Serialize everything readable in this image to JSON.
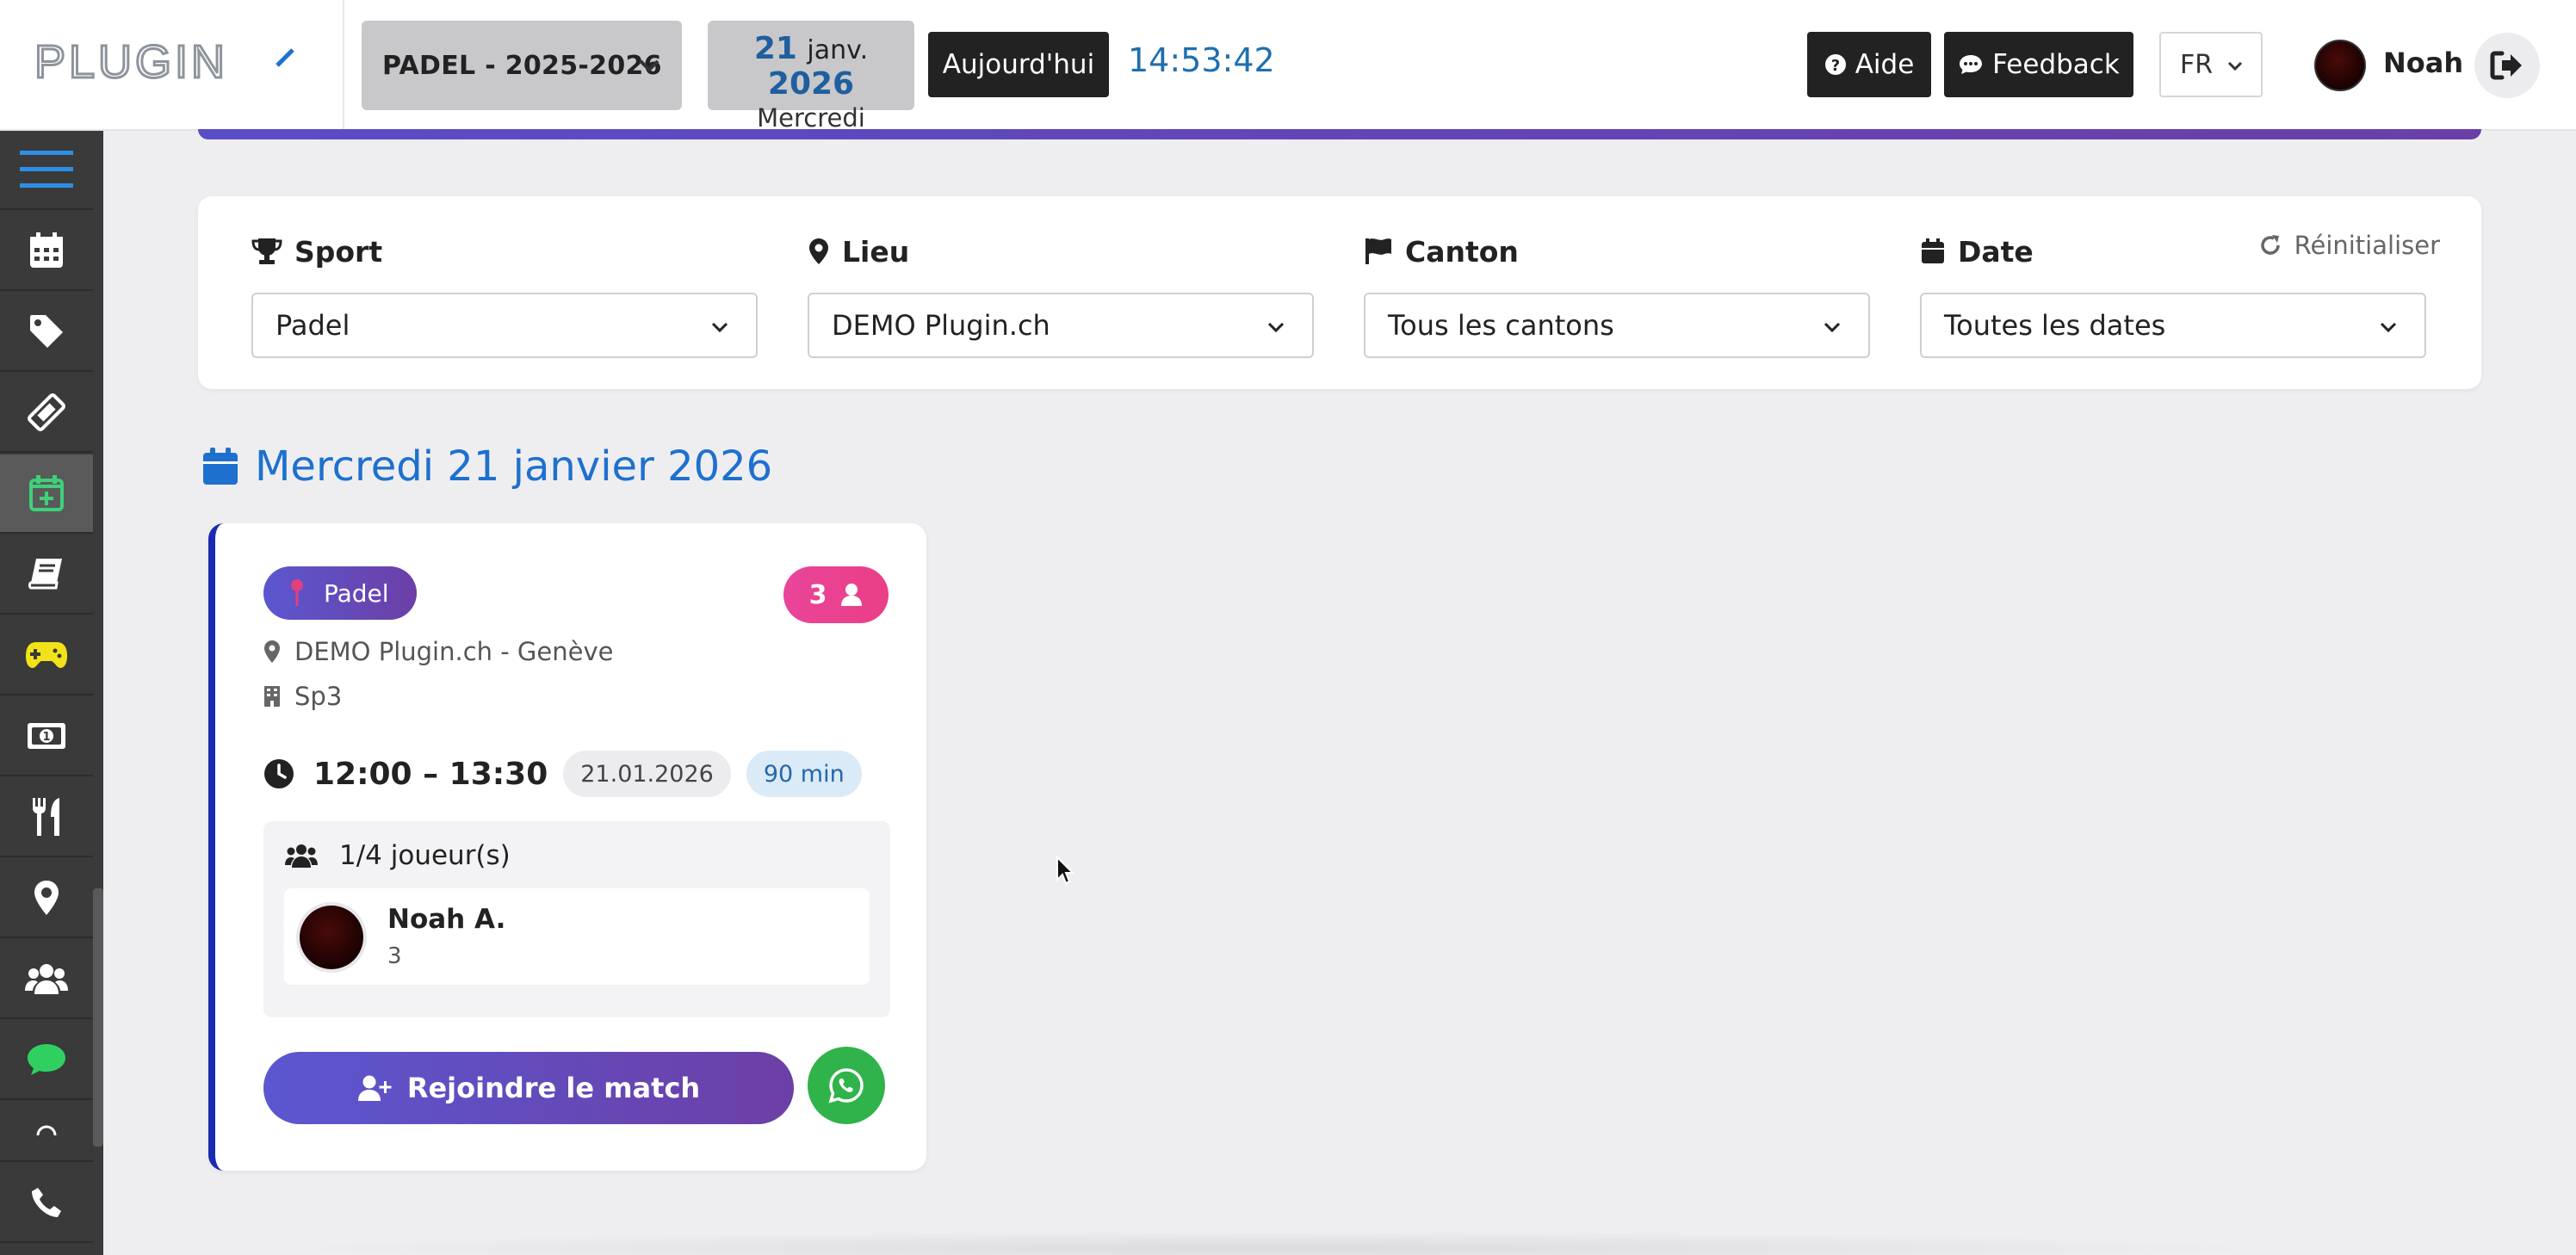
{
  "header": {
    "logo_text": "PLUGIN",
    "season": "PADEL - 2025-2026",
    "date": {
      "day": "21",
      "month": "janv.",
      "year": "2026",
      "weekday": "Mercredi"
    },
    "today_label": "Aujourd'hui",
    "clock": "14:53:42",
    "help_label": "Aide",
    "feedback_label": "Feedback",
    "language": "FR",
    "user_name": "Noah"
  },
  "sidebar": {
    "items": [
      {
        "icon": "menu-icon"
      },
      {
        "icon": "calendar-icon"
      },
      {
        "icon": "tag-icon"
      },
      {
        "icon": "ticket-icon"
      },
      {
        "icon": "calendar-plus-icon",
        "active": true
      },
      {
        "icon": "book-icon"
      },
      {
        "icon": "gamepad-icon"
      },
      {
        "icon": "money-icon"
      },
      {
        "icon": "utensils-icon"
      },
      {
        "icon": "map-marker-icon"
      },
      {
        "icon": "users-icon"
      },
      {
        "icon": "chat-icon"
      },
      {
        "icon": "loading-icon"
      },
      {
        "icon": "phone-icon"
      }
    ],
    "colors": {
      "calendar-plus": "#3fd07a",
      "gamepad": "#f2e21a",
      "chat": "#2fd060"
    }
  },
  "filters": {
    "sport": {
      "label": "Sport",
      "value": "Padel"
    },
    "lieu": {
      "label": "Lieu",
      "value": "DEMO Plugin.ch"
    },
    "canton": {
      "label": "Canton",
      "value": "Tous les cantons"
    },
    "date": {
      "label": "Date",
      "value": "Toutes les dates"
    },
    "reset_label": "Réinitialiser"
  },
  "day_heading": "Mercredi 21 janvier 2026",
  "match": {
    "sport": "Padel",
    "count": "3",
    "location": "DEMO Plugin.ch - Genève",
    "court": "Sp3",
    "time": "12:00 – 13:30",
    "date": "21.01.2026",
    "duration": "90 min",
    "players_label": "1/4 joueur(s)",
    "players": [
      {
        "name": "Noah A.",
        "level": "3"
      }
    ],
    "join_label": "Rejoindre le match"
  },
  "colors": {
    "accent_blue": "#1e70cf",
    "purple": "#5b57d0",
    "pink": "#e9449a",
    "whatsapp": "#2fb34a"
  }
}
